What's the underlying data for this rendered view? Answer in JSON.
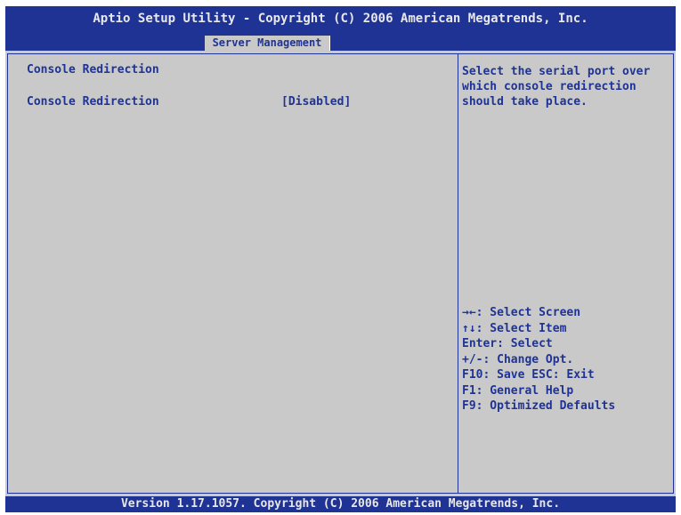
{
  "header": {
    "title": "Aptio Setup Utility - Copyright (C) 2006 American Megatrends, Inc.",
    "active_tab": "Server Management"
  },
  "main": {
    "section_heading": "Console Redirection",
    "settings": [
      {
        "label": "Console Redirection",
        "value": "[Disabled]"
      }
    ]
  },
  "help": {
    "description_lines": [
      "Select the serial port over",
      "which console redirection",
      "should take place."
    ],
    "keys": [
      "→←: Select Screen",
      "↑↓: Select Item",
      "Enter: Select",
      "+/-: Change Opt.",
      "F10: Save  ESC: Exit",
      "F1: General Help",
      "F9: Optimized Defaults"
    ]
  },
  "footer": {
    "text": "Version 1.17.1057. Copyright (C) 2006 American Megatrends, Inc."
  },
  "colors": {
    "bios_blue": "#1f3394",
    "panel_gray": "#c9c9c9",
    "header_text": "#e8e8e8"
  }
}
